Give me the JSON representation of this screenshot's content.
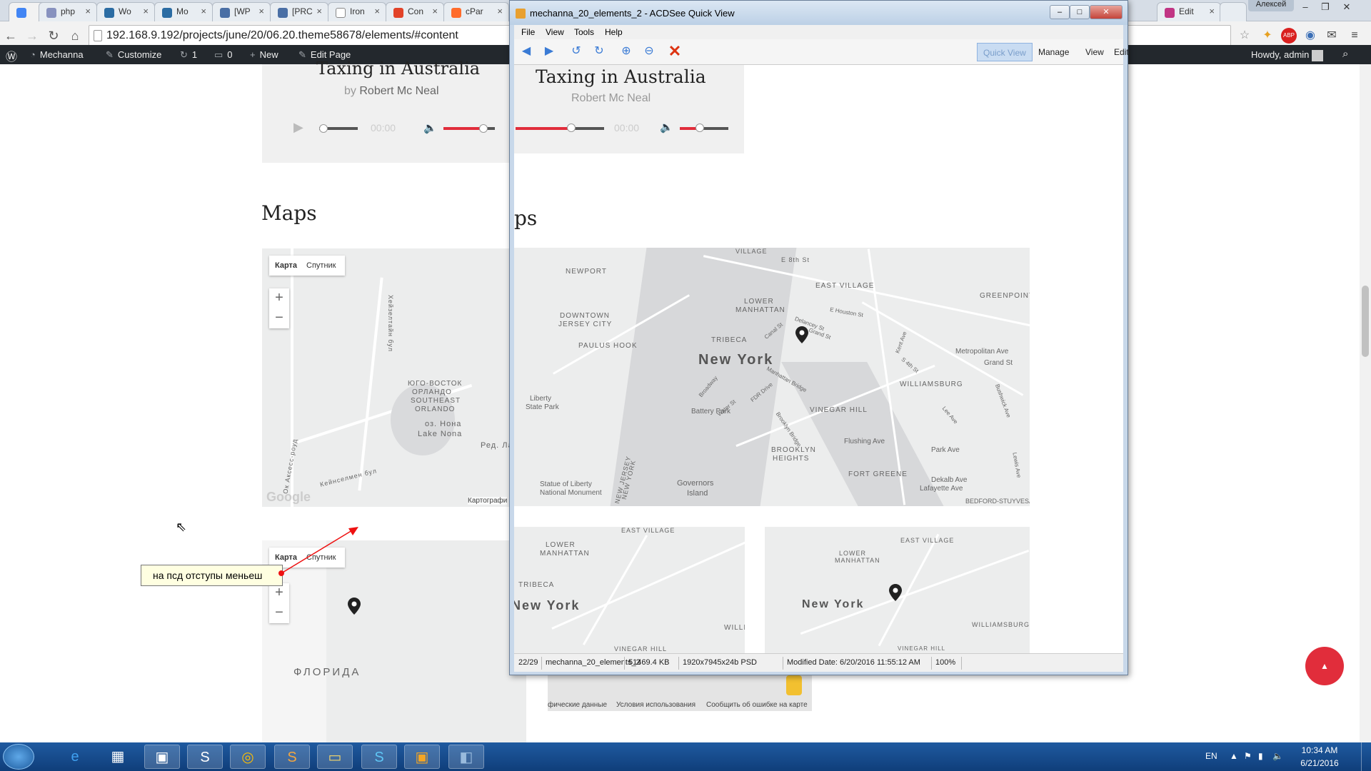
{
  "browser": {
    "tabs": [
      {
        "label": "php",
        "color": "#8892bf"
      },
      {
        "label": "Wo",
        "color": "#2b6ca3"
      },
      {
        "label": "Mo",
        "color": "#2b6ca3"
      },
      {
        "label": "[WP",
        "color": "#4a6fa5"
      },
      {
        "label": "[PRC",
        "color": "#4a6fa5"
      },
      {
        "label": "Iron",
        "color": "#888888"
      },
      {
        "label": "Con",
        "color": "#e24329"
      },
      {
        "label": "cPar",
        "color": "#ff6c2c"
      },
      {
        "label": "Edit",
        "color": "#c13584"
      }
    ],
    "user_label": "Алексей",
    "url": "192.168.9.192/projects/june/20/06.20.theme58678/elements/#content"
  },
  "adminbar": {
    "site": "Mechanna",
    "customize": "Customize",
    "updates": "1",
    "comments": "0",
    "new": "New",
    "edit_page": "Edit Page",
    "howdy": "Howdy, admin"
  },
  "page": {
    "audio_title": "Taxing in Australia",
    "audio_by": "by",
    "audio_author": "Robert Mc Neal",
    "time": "00:00",
    "maps_heading": "Maps",
    "map_type_map": "Карта",
    "map_type_sat": "Спутник",
    "map1_labels": [
      "ЮГО-ВОСТОК",
      "ОРЛАНДО",
      "SOUTHEAST",
      "ORLANDO",
      "оз. Нона",
      "Lake Nona",
      "Ред. Ла",
      "Хейзелтайн бул",
      "Кейнселмен бул",
      "Ок Аксесс-роуд"
    ],
    "map1_attribution": "Картографи",
    "map2_label": "ФЛОРИДА",
    "map2_footer": [
      "фические данные",
      "Условия использования",
      "Сообщить об ошибке на карте"
    ]
  },
  "acdsee": {
    "title": "mechanna_20_elements_2 - ACDSee Quick View",
    "menu": [
      "File",
      "View",
      "Tools",
      "Help"
    ],
    "modes": [
      "Quick View",
      "Manage",
      "View",
      "Edit"
    ],
    "heading_fragment": "ps",
    "map_big_labels": [
      "VILLAGE",
      "E 8th St",
      "EAST VILLAGE",
      "LOWER",
      "MANHATTAN",
      "NEWPORT",
      "DOWNTOWN",
      "JERSEY CITY",
      "PAULUS HOOK",
      "TRIBECA",
      "New York",
      "GREENPOINT",
      "Metropolitan Ave",
      "Grand St",
      "WILLIAMSBURG",
      "VINEGAR HILL",
      "Flushing Ave",
      "Liberty",
      "State Park",
      "Battery Park",
      "BROOKLYN",
      "HEIGHTS",
      "FORT GREENE",
      "Park Ave",
      "Dekalb Ave",
      "Lafayette Ave",
      "BEDFORD-STUYVESA",
      "Statue of Liberty",
      "National Monument",
      "Governors",
      "Island",
      "NEW JERSEY",
      "NEW YORK",
      "Delancey St",
      "Grand St",
      "E Houston St",
      "Canal St",
      "Broadway",
      "FDR Drive",
      "Water St",
      "Kent Ave",
      "S 4th St",
      "Bushwick Ave",
      "Lewis Ave",
      "Lee Ave",
      "Manhattan Bridge",
      "Brooklyn Bridge"
    ],
    "map_small_labels": [
      "LOWER",
      "MANHATTAN",
      "EAST VILLAGE",
      "TRIBECA",
      "New York",
      "WILLIA",
      "VINEGAR HILL",
      "WILLIAMSBURG"
    ],
    "status": {
      "index": "22/29",
      "filename": "mechanna_20_elements_2",
      "size": "51469.4 KB",
      "dims": "1920x7945x24b PSD",
      "modified": "Modified Date: 6/20/2016 11:55:12 AM",
      "zoom": "100%"
    }
  },
  "annotation": {
    "note": "на псд отступы меньеш"
  },
  "taskbar": {
    "lang": "EN",
    "time": "10:34 AM",
    "date": "6/21/2016"
  },
  "colors": {
    "accent_red": "#e12d3b",
    "admin_bar": "#23282d",
    "taskbar": "#1a4f8f"
  }
}
